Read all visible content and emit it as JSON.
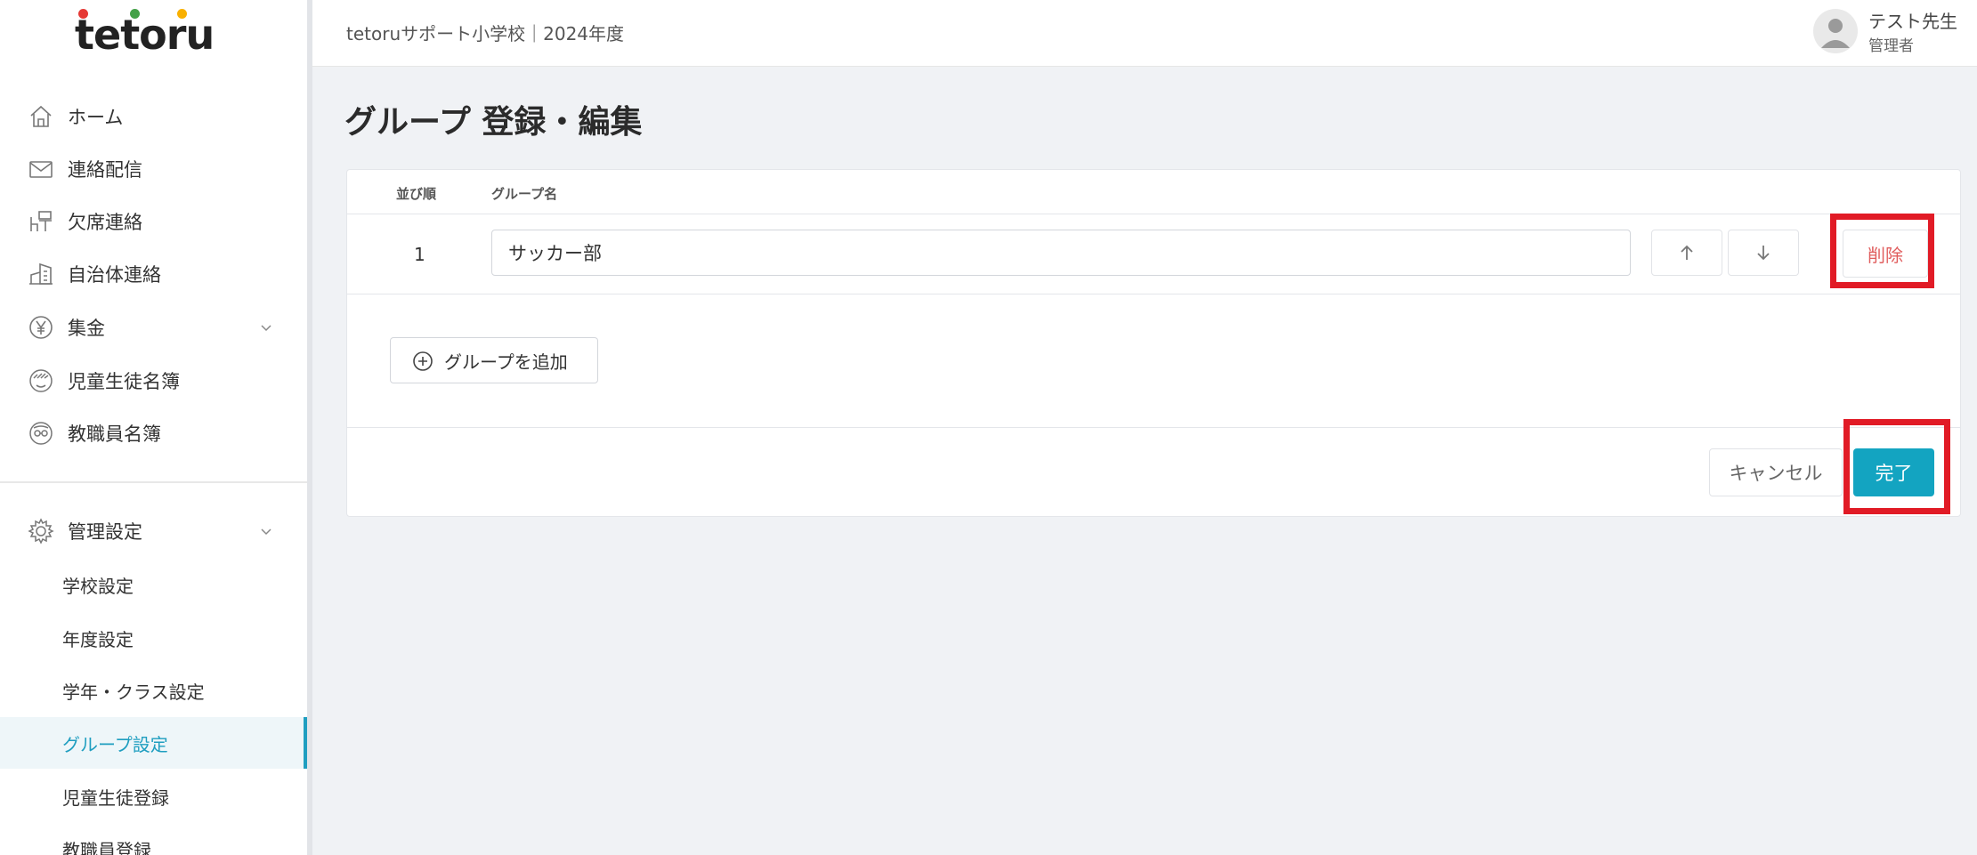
{
  "brand": {
    "logo_text": "tetoru",
    "dot_colors": [
      "#e53935",
      "#43a047",
      "#f9b000"
    ]
  },
  "sidebar": {
    "items": [
      {
        "label": "ホーム",
        "icon": "home-icon"
      },
      {
        "label": "連絡配信",
        "icon": "mail-icon"
      },
      {
        "label": "欠席連絡",
        "icon": "desk-chair-icon"
      },
      {
        "label": "自治体連絡",
        "icon": "building-icon"
      },
      {
        "label": "集金",
        "icon": "yen-icon",
        "expandable": true
      },
      {
        "label": "児童生徒名簿",
        "icon": "student-icon"
      },
      {
        "label": "教職員名簿",
        "icon": "teacher-icon"
      }
    ],
    "admin": {
      "label": "管理設定",
      "icon": "gear-icon",
      "expandable": true
    },
    "sub_items": [
      {
        "label": "学校設定"
      },
      {
        "label": "年度設定"
      },
      {
        "label": "学年・クラス設定"
      },
      {
        "label": "グループ設定",
        "active": true
      },
      {
        "label": "児童生徒登録"
      },
      {
        "label": "教職員登録"
      }
    ]
  },
  "header": {
    "title": "tetoruサポート小学校｜2024年度",
    "user_name": "テスト先生",
    "user_role": "管理者"
  },
  "page": {
    "title": "グループ 登録・編集"
  },
  "table": {
    "col_order": "並び順",
    "col_name": "グループ名",
    "rows": [
      {
        "order": "1",
        "name": "サッカー部"
      }
    ]
  },
  "actions": {
    "delete": "削除",
    "add_group": "グループを追加",
    "cancel": "キャンセル",
    "done": "完了"
  },
  "colors": {
    "accent": "#13a4c1",
    "danger_text": "#e05d5d",
    "highlight": "#e11b26"
  }
}
